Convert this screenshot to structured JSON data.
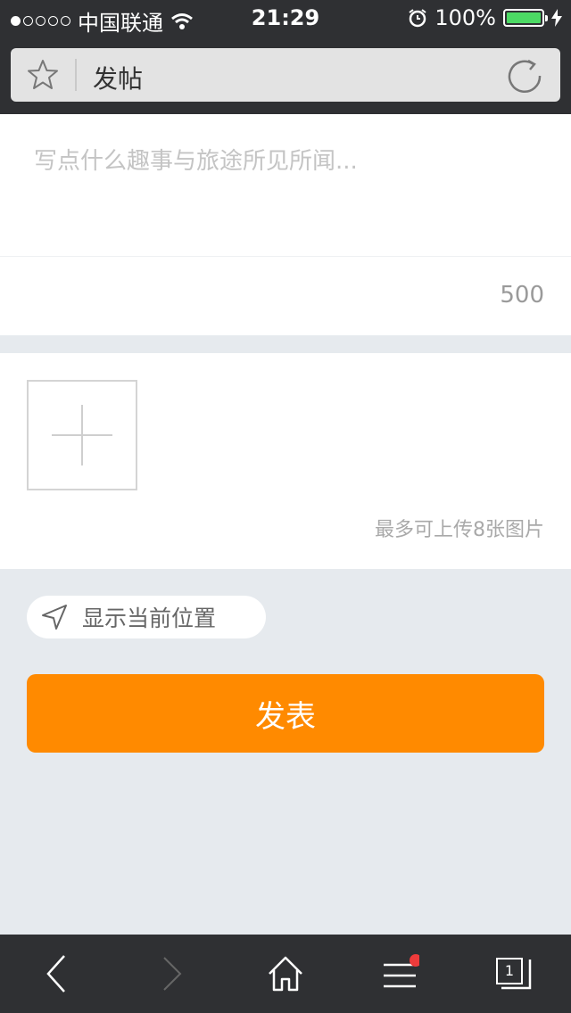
{
  "status_bar": {
    "carrier": "中国联通",
    "time": "21:29",
    "battery": "100%"
  },
  "address_bar": {
    "title": "发帖"
  },
  "post": {
    "placeholder": "写点什么趣事与旅途所见所闻...",
    "char_count": "500"
  },
  "images": {
    "hint": "最多可上传8张图片"
  },
  "location": {
    "label": "显示当前位置"
  },
  "actions": {
    "submit_label": "发表"
  },
  "toolbar": {
    "tab_count": "1"
  },
  "colors": {
    "accent": "#ff8a00",
    "bar_background": "#2f3033",
    "page_background": "#e6eaee",
    "notification_dot": "#ee3b3b",
    "battery": "#4cd964"
  }
}
